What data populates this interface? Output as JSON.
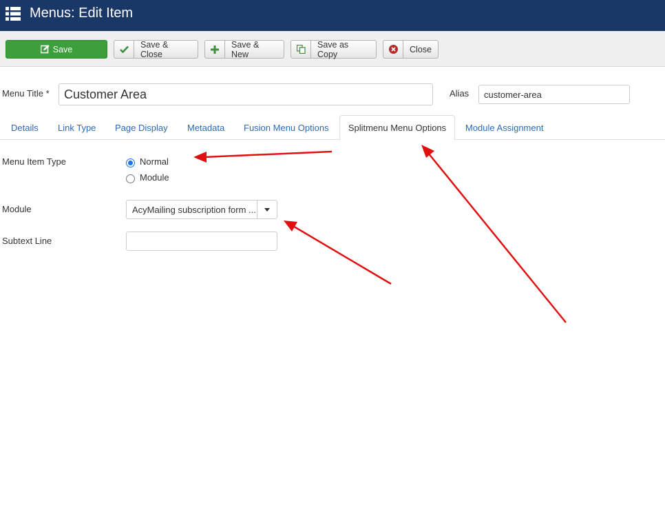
{
  "header": {
    "title": "Menus: Edit Item",
    "icon": "list-icon"
  },
  "toolbar": {
    "save_label": "Save",
    "save_close_label": "Save & Close",
    "save_new_label": "Save & New",
    "save_copy_label": "Save as Copy",
    "close_label": "Close"
  },
  "form": {
    "menu_title_label": "Menu Title *",
    "menu_title_value": "Customer Area",
    "alias_label": "Alias",
    "alias_value": "customer-area"
  },
  "tabs": [
    {
      "label": "Details"
    },
    {
      "label": "Link Type"
    },
    {
      "label": "Page Display"
    },
    {
      "label": "Metadata"
    },
    {
      "label": "Fusion Menu Options"
    },
    {
      "label": "Splitmenu Menu Options",
      "active": true
    },
    {
      "label": "Module Assignment"
    }
  ],
  "fields": {
    "menu_item_type_label": "Menu Item Type",
    "option_normal": "Normal",
    "option_module": "Module",
    "selected_option": "Normal",
    "module_label": "Module",
    "module_value": "AcyMailing subscription form ...",
    "subtext_label": "Subtext Line",
    "subtext_value": ""
  },
  "colors": {
    "header_bg": "#1a3867",
    "save_green": "#3d9e3c",
    "link_blue": "#2a69b8",
    "annotation_red": "#e01010"
  }
}
